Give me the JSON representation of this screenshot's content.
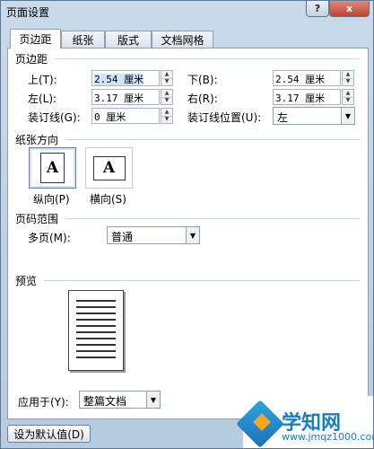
{
  "window": {
    "title": "页面设置",
    "help_label": "?",
    "close_label": "x"
  },
  "tabs": [
    {
      "label": "页边距",
      "active": true
    },
    {
      "label": "纸张",
      "active": false
    },
    {
      "label": "版式",
      "active": false
    },
    {
      "label": "文档网格",
      "active": false
    }
  ],
  "margins": {
    "section_title": "页边距",
    "top_label": "上(T):",
    "top_value": "2.54 厘米",
    "bottom_label": "下(B):",
    "bottom_value": "2.54 厘米",
    "left_label": "左(L):",
    "left_value": "3.17 厘米",
    "right_label": "右(R):",
    "right_value": "3.17 厘米",
    "gutter_label": "装订线(G):",
    "gutter_value": "0 厘米",
    "gutter_pos_label": "装订线位置(U):",
    "gutter_pos_value": "左"
  },
  "orientation": {
    "section_title": "纸张方向",
    "portrait_label": "纵向(P)",
    "landscape_label": "横向(S)",
    "icon_letter": "A",
    "selected": "portrait"
  },
  "pages": {
    "section_title": "页码范围",
    "multiple_label": "多页(M):",
    "multiple_value": "普通"
  },
  "preview": {
    "section_title": "预览",
    "apply_label": "应用于(Y):",
    "apply_value": "整篇文档"
  },
  "buttons": {
    "default_label": "设为默认值(D)"
  },
  "watermark": {
    "title": "学知网",
    "url": "www.jmqz1000.com"
  },
  "colors": {
    "accent": "#1d7dc1",
    "close": "#c2432f"
  }
}
